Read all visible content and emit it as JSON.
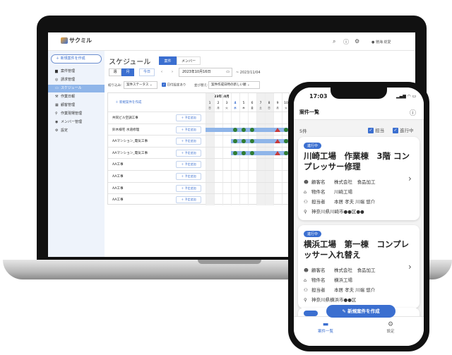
{
  "laptop": {
    "header": {
      "logo": "サクミル",
      "user": "徳海 総愛"
    },
    "sidebar": {
      "new_button": "新規案件を作成",
      "items": [
        {
          "label": "案件管理",
          "icon": "briefcase-icon"
        },
        {
          "label": "請求管理",
          "icon": "currency-icon"
        },
        {
          "label": "スケジュール",
          "icon": "calendar-icon",
          "active": true
        },
        {
          "label": "作業日報",
          "icon": "tools-icon"
        },
        {
          "label": "顧客管理",
          "icon": "building-icon"
        },
        {
          "label": "作業現場管理",
          "icon": "location-icon"
        },
        {
          "label": "メンバー管理",
          "icon": "person-icon"
        },
        {
          "label": "設定",
          "icon": "gear-icon"
        }
      ]
    },
    "main": {
      "title": "スケジュール",
      "tabs": [
        "案件",
        "メンバー"
      ],
      "active_tab": "案件",
      "view_week": "週",
      "view_month": "月",
      "today": "今日",
      "prev": "‹",
      "next": "›",
      "date_from": "2023年10月16日",
      "date_to": "~ 2023/11/04",
      "filter_label": "絞り込み:",
      "filter_value": "案件ステータス",
      "date_set_label": "日付設定あり",
      "sort_label": "並び替え:",
      "sort_value": "案件作成日時の新しい順"
    },
    "gantt": {
      "new_case": "新規案件を作成",
      "month": "2023年10月",
      "today_day": "4",
      "days": [
        {
          "d": "1",
          "w": "日"
        },
        {
          "d": "2",
          "w": "月"
        },
        {
          "d": "3",
          "w": "火"
        },
        {
          "d": "4",
          "w": "水"
        },
        {
          "d": "5",
          "w": "木"
        },
        {
          "d": "6",
          "w": "金"
        },
        {
          "d": "7",
          "w": "土"
        },
        {
          "d": "8",
          "w": "日"
        },
        {
          "d": "9",
          "w": "月"
        },
        {
          "d": "10",
          "w": "火"
        }
      ],
      "add_label": "予定追加",
      "rows": [
        {
          "name": "共同ビル空調工事"
        },
        {
          "name": "鈴木様宅 水道修理",
          "bar": [
            1,
            10
          ],
          "ok": [
            4,
            5,
            6,
            10
          ],
          "warn": [
            9
          ]
        },
        {
          "name": "AAマンション_電気工事",
          "bar": [
            4,
            10
          ],
          "ok": [
            4,
            5,
            6,
            10
          ],
          "warn": [
            9
          ]
        },
        {
          "name": "AAマンション_電気工事",
          "bar": [
            4,
            10
          ],
          "ok": [
            4,
            5,
            6,
            10
          ],
          "warn": [
            9
          ]
        },
        {
          "name": "AA工事"
        },
        {
          "name": "AA工事"
        },
        {
          "name": "AA工事"
        },
        {
          "name": "AA工事"
        }
      ]
    }
  },
  "phone": {
    "time": "17:03",
    "title": "案件一覧",
    "count": "5件",
    "filter_assigned": "担当",
    "filter_in_progress": "進行中",
    "cards": [
      {
        "status": "進行中",
        "title": "川崎工場　作業棟　3階 コンプレッサー修理",
        "customer_label": "顧客名",
        "customer": "株式会社　食品加工",
        "property_label": "物件名",
        "property": "川崎工場",
        "staff_label": "担当者",
        "staff": "本居 孝夫 川端 悠介",
        "address": "神奈川県川崎市●●区●●"
      },
      {
        "status": "進行中",
        "title": "横浜工場　第一棟　コンプレッサー入れ替え",
        "customer_label": "顧客名",
        "customer": "株式会社　食品加工",
        "property_label": "物件名",
        "property": "横浜工場",
        "staff_label": "担当者",
        "staff": "本居 孝夫 川端 悠介",
        "address": "神奈川県横浜市●●区"
      }
    ],
    "fab": "新規案件を作成",
    "nav": [
      {
        "label": "案件一覧",
        "icon": "folder-icon",
        "active": true
      },
      {
        "label": "設定",
        "icon": "gear-icon"
      }
    ]
  },
  "colors": {
    "accent": "#3b6fd0",
    "bar": "#8fb5e9",
    "ok": "#2f7d32",
    "warn": "#c83a3a"
  }
}
